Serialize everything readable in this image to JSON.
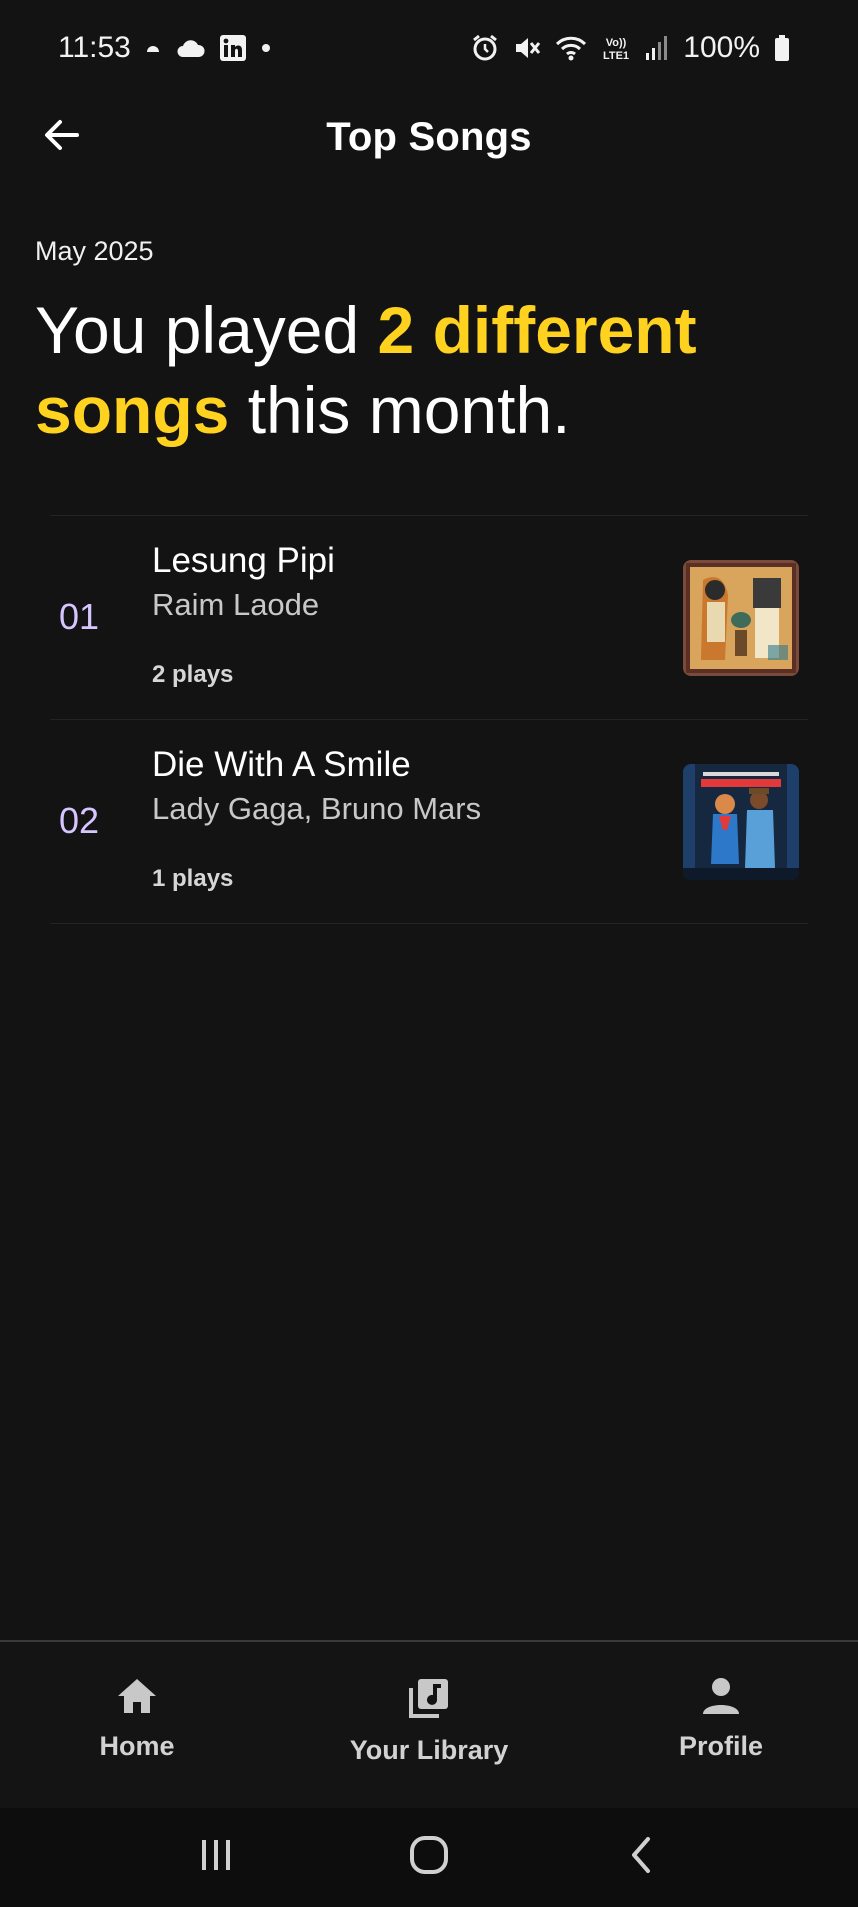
{
  "status_bar": {
    "time": "11:53",
    "battery": "100%",
    "left_icons": [
      "weather-icon",
      "cloud-icon",
      "linkedin-icon",
      "dot-icon"
    ],
    "right_icons": [
      "alarm-icon",
      "mute-icon",
      "wifi-icon",
      "volte-icon",
      "signal-icon",
      "battery-icon"
    ]
  },
  "header": {
    "title": "Top Songs",
    "back_icon": "arrow-back-icon"
  },
  "summary": {
    "month": "May 2025",
    "prefix": "You played ",
    "highlight": "2 different songs",
    "suffix": " this month."
  },
  "songs": [
    {
      "rank": "01",
      "title": "Lesung Pipi",
      "artist": "Raim Laode",
      "plays": "2 plays"
    },
    {
      "rank": "02",
      "title": "Die With A Smile",
      "artist": "Lady Gaga, Bruno Mars",
      "plays": "1 plays"
    }
  ],
  "bottom_nav": {
    "items": [
      {
        "label": "Home",
        "icon": "home-icon"
      },
      {
        "label": "Your Library",
        "icon": "library-music-icon"
      },
      {
        "label": "Profile",
        "icon": "person-icon"
      }
    ]
  },
  "system_nav": [
    "recent-apps-icon",
    "home-circle-icon",
    "back-chevron-icon"
  ],
  "colors": {
    "background": "#131313",
    "highlight": "#ffd21f",
    "rank": "#d7c5ff"
  }
}
